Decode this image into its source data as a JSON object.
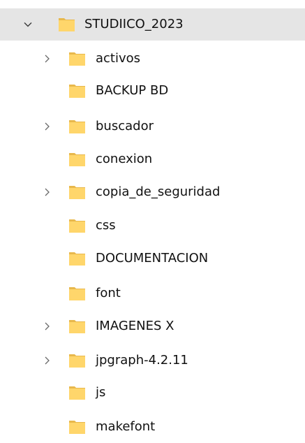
{
  "tree": {
    "root": {
      "label": "STUDIICO_2023",
      "expanded": true,
      "selected": true
    },
    "children": [
      {
        "label": "activos",
        "has_children": true
      },
      {
        "label": "BACKUP BD",
        "has_children": false
      },
      {
        "label": "buscador",
        "has_children": true
      },
      {
        "label": "conexion",
        "has_children": false
      },
      {
        "label": "copia_de_seguridad",
        "has_children": true
      },
      {
        "label": "css",
        "has_children": false
      },
      {
        "label": "DOCUMENTACION",
        "has_children": false
      },
      {
        "label": "font",
        "has_children": false
      },
      {
        "label": "IMAGENES X",
        "has_children": true
      },
      {
        "label": "jpgraph-4.2.11",
        "has_children": true
      },
      {
        "label": "js",
        "has_children": false
      },
      {
        "label": "makefont",
        "has_children": false
      }
    ]
  },
  "colors": {
    "selected_row": "#e5e5e5",
    "folder_fill": "#ffd66b",
    "folder_back": "#e8b84c",
    "text": "#111111",
    "chevron": "#5a5a5a"
  }
}
